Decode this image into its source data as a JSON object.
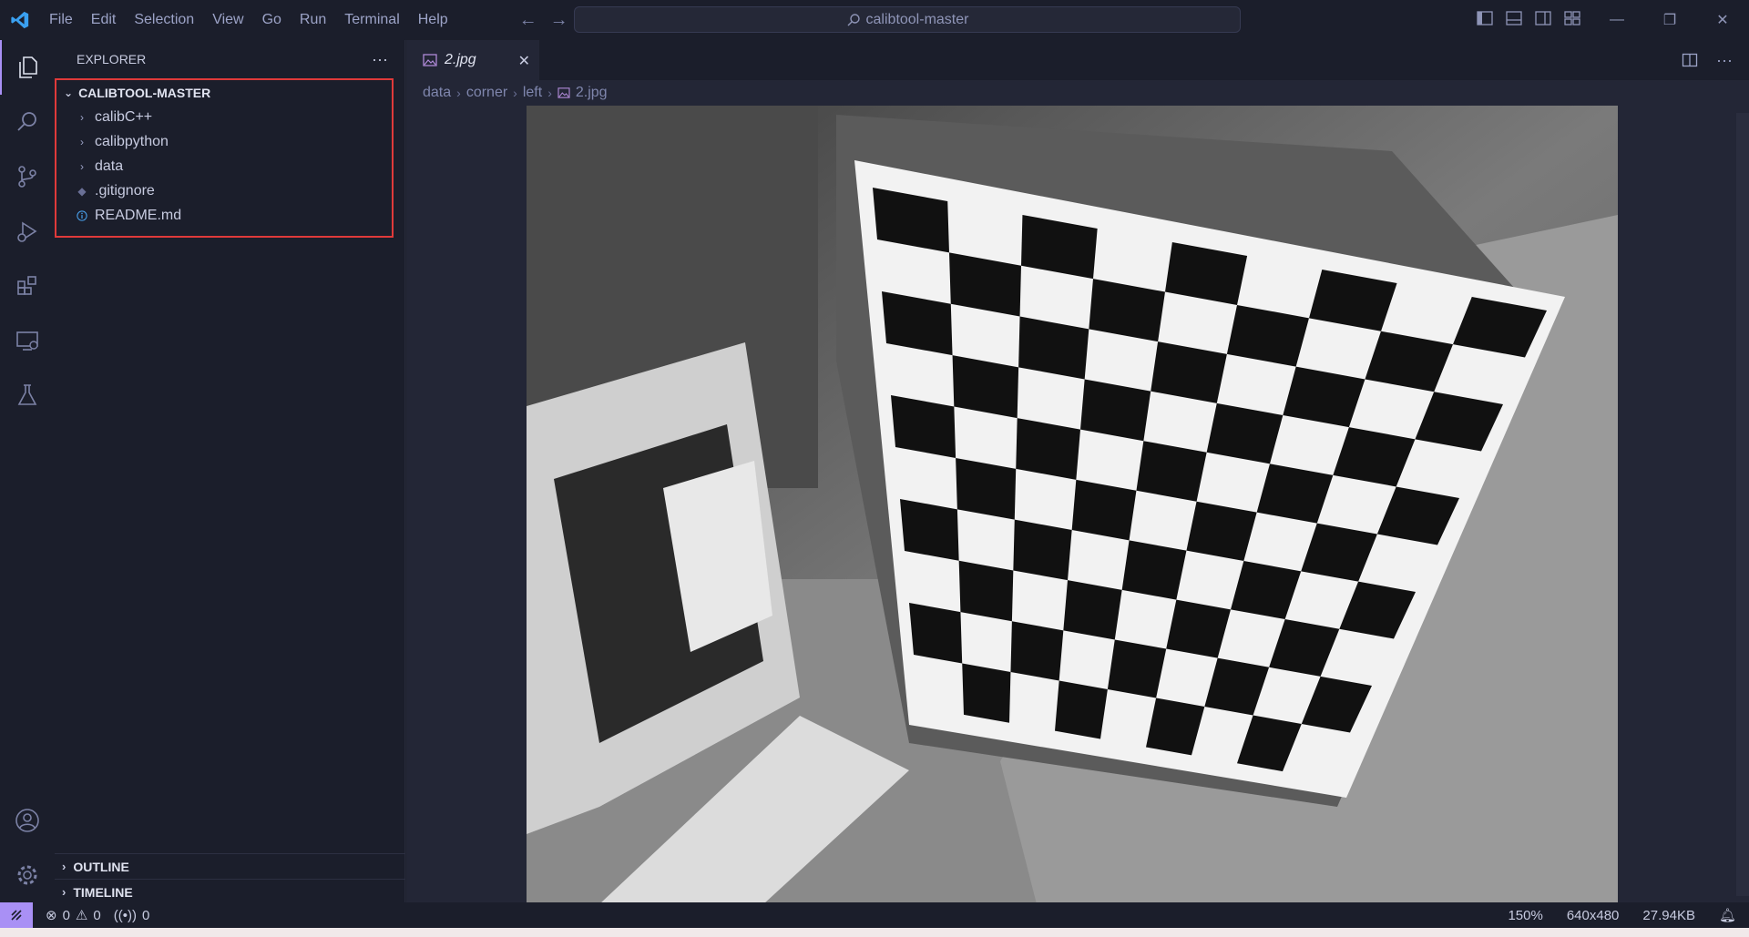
{
  "menu": [
    "File",
    "Edit",
    "Selection",
    "View",
    "Go",
    "Run",
    "Terminal",
    "Help"
  ],
  "search": {
    "text": "calibtool-master"
  },
  "sidebar": {
    "title": "EXPLORER",
    "more": "···",
    "folder": "CALIBTOOL-MASTER",
    "items": [
      {
        "label": "calibC++",
        "type": "folder"
      },
      {
        "label": "calibpython",
        "type": "folder"
      },
      {
        "label": "data",
        "type": "folder"
      },
      {
        "label": ".gitignore",
        "type": "file"
      },
      {
        "label": "README.md",
        "type": "info"
      }
    ],
    "outline": "OUTLINE",
    "timeline": "TIMELINE"
  },
  "editor": {
    "tab": "2.jpg",
    "breadcrumb": [
      "data",
      "corner",
      "left",
      "2.jpg"
    ],
    "image_description": "grayscale photo of checkerboard calibration target"
  },
  "status": {
    "errors": "0",
    "warnings": "0",
    "ports": "0",
    "zoom": "150%",
    "dimensions": "640x480",
    "size": "27.94KB"
  },
  "colors": {
    "accent": "#a990f5",
    "highlight_box": "#e03a3a",
    "background": "#1f2230"
  }
}
